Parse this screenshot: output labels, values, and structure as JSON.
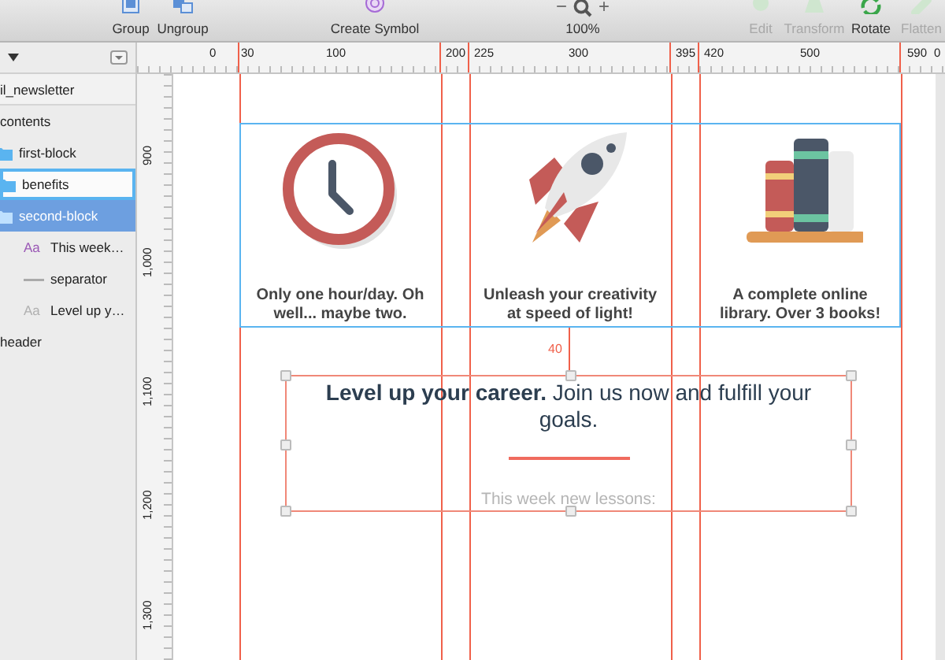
{
  "toolbar": {
    "items": [
      {
        "kind": "group",
        "label": "Group",
        "disabled": false
      },
      {
        "kind": "ungroup",
        "label": "Ungroup",
        "disabled": false
      },
      {
        "kind": "symbol",
        "label": "Create Symbol",
        "disabled": false
      },
      {
        "kind": "zoom",
        "minus": "−",
        "plus": "+",
        "label": "100%",
        "disabled": false
      },
      {
        "kind": "edit",
        "label": "Edit",
        "disabled": true
      },
      {
        "kind": "transform",
        "label": "Transform",
        "disabled": true
      },
      {
        "kind": "rotate",
        "label": "Rotate",
        "disabled": false
      },
      {
        "kind": "flatten",
        "label": "Flatten",
        "disabled": true
      }
    ]
  },
  "layers": [
    {
      "kind": "artboard",
      "label": "il_newsletter",
      "selected": false,
      "hovered": false
    },
    {
      "kind": "group",
      "label": "contents",
      "selected": false,
      "hovered": false,
      "children": [
        {
          "kind": "folder",
          "label": "first-block",
          "selected": false,
          "hovered": false
        },
        {
          "kind": "folder",
          "label": "benefits",
          "selected": false,
          "hovered": true
        },
        {
          "kind": "folder",
          "label": "second-block",
          "selected": true,
          "hovered": false,
          "children": [
            {
              "kind": "text",
              "glyph": "Aa",
              "color": "#9b59b6",
              "label": "This week…",
              "selected": false,
              "hovered": false
            },
            {
              "kind": "line",
              "label": "separator",
              "selected": false,
              "hovered": false
            },
            {
              "kind": "text",
              "glyph": "Aa",
              "color": "#b0b0b0",
              "label": "Level up y…",
              "selected": false,
              "hovered": false
            }
          ]
        }
      ]
    },
    {
      "kind": "group",
      "label": "header",
      "selected": false,
      "hovered": false
    }
  ],
  "rulers": {
    "horizontal": [
      "0",
      "30",
      "100",
      "200",
      "225",
      "300",
      "395",
      "420",
      "500",
      "590",
      "0"
    ],
    "vertical": [
      "900",
      "1,000",
      "1,100",
      "1,200",
      "1,300"
    ]
  },
  "canvas": {
    "benefits": [
      {
        "kind": "clock",
        "text": "Only one hour/day. Oh well... maybe two."
      },
      {
        "kind": "rocket",
        "text": "Unleash your creativity at speed of light!"
      },
      {
        "kind": "books",
        "text": "A complete online library. Over 3 books!"
      }
    ],
    "spacing_label": "40",
    "heading": "**Level up your career.** Join us now and fulfill your goals.",
    "subheading": "This week new lessons:"
  }
}
